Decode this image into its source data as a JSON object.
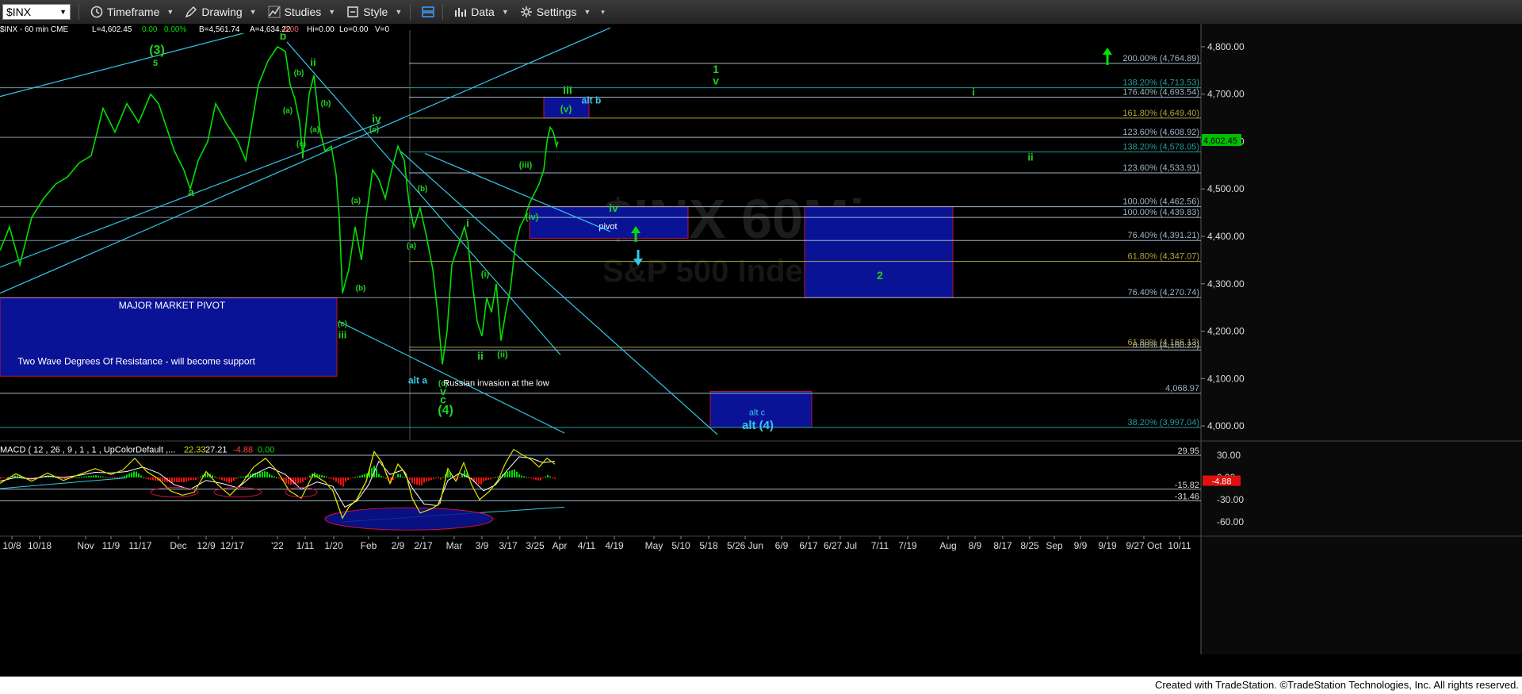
{
  "toolbar": {
    "symbol": "$INX",
    "items": [
      "Timeframe",
      "Drawing",
      "Studies",
      "Style",
      "Data",
      "Settings"
    ]
  },
  "colors": {
    "price": "#00e000",
    "cyan": "#33c8e8",
    "green_label": "#21d021",
    "pivot_fill": "#0a1396",
    "pivot_border": "#c0103a",
    "fib_line": "#9fb6c8",
    "fib_gold": "#8a8a20",
    "macd_line": "#e0e000",
    "macd_signal": "#ffffff",
    "hist_up": "#00e000",
    "hist_down": "#ff1010"
  },
  "chart_data": {
    "type": "line",
    "title": "$INX - 60 min CME",
    "header": {
      "symbol_label": "$INX - 60 min  CME",
      "last": "L=4,602.45",
      "change": "0.00",
      "pct": "0.00%",
      "bid": "B=4,561.74",
      "ask": "A=4,634.22",
      "hi_lo_change": "-0.00",
      "hi": "Hi=0.00",
      "lo": "Lo=0.00",
      "vol": "V=0"
    },
    "watermark": "$INX  60Min",
    "watermark2": "S&P 500 Index",
    "y_axis": {
      "ticks": [
        4000,
        4100,
        4200,
        4300,
        4400,
        4500,
        4600,
        4700,
        4800
      ],
      "tick_labels": [
        "4,000.00",
        "4,100.00",
        "4,200.00",
        "4,300.00",
        "4,400.00",
        "4,500.00",
        "4,600.00",
        "4,700.00",
        "4,800.00"
      ],
      "range": [
        3975,
        4835
      ],
      "last_price_label": "4,602.45"
    },
    "x_axis": {
      "tick_labels": [
        "10/8",
        "10/18",
        "Nov",
        "11/9",
        "11/17",
        "Dec",
        "12/9",
        "12/17",
        "'22",
        "1/11",
        "1/20",
        "Feb",
        "2/9",
        "2/17",
        "Mar",
        "3/9",
        "3/17",
        "3/25",
        "Apr",
        "4/11",
        "4/19",
        "May",
        "5/10",
        "5/18",
        "5/26 Jun",
        "6/9",
        "6/17",
        "6/27 Jul",
        "7/11",
        "7/19",
        "Aug",
        "8/9",
        "8/17",
        "8/25",
        "Sep",
        "9/9",
        "9/19",
        "9/27 Oct",
        "10/11"
      ]
    },
    "price_series": [
      [
        0,
        4370
      ],
      [
        12,
        4420
      ],
      [
        25,
        4340
      ],
      [
        40,
        4440
      ],
      [
        55,
        4480
      ],
      [
        70,
        4510
      ],
      [
        85,
        4525
      ],
      [
        100,
        4555
      ],
      [
        115,
        4570
      ],
      [
        130,
        4670
      ],
      [
        145,
        4620
      ],
      [
        160,
        4680
      ],
      [
        175,
        4640
      ],
      [
        190,
        4700
      ],
      [
        200,
        4680
      ],
      [
        208,
        4640
      ],
      [
        220,
        4580
      ],
      [
        232,
        4540
      ],
      [
        240,
        4500
      ],
      [
        250,
        4560
      ],
      [
        262,
        4600
      ],
      [
        272,
        4680
      ],
      [
        285,
        4640
      ],
      [
        300,
        4600
      ],
      [
        310,
        4560
      ],
      [
        318,
        4640
      ],
      [
        326,
        4720
      ],
      [
        338,
        4770
      ],
      [
        350,
        4800
      ],
      [
        360,
        4790
      ],
      [
        366,
        4720
      ],
      [
        372,
        4690
      ],
      [
        378,
        4640
      ],
      [
        382,
        4570
      ],
      [
        390,
        4700
      ],
      [
        396,
        4740
      ],
      [
        404,
        4620
      ],
      [
        410,
        4580
      ],
      [
        418,
        4590
      ],
      [
        424,
        4530
      ],
      [
        428,
        4440
      ],
      [
        432,
        4280
      ],
      [
        440,
        4330
      ],
      [
        448,
        4420
      ],
      [
        456,
        4350
      ],
      [
        462,
        4440
      ],
      [
        470,
        4540
      ],
      [
        478,
        4520
      ],
      [
        486,
        4480
      ],
      [
        494,
        4540
      ],
      [
        502,
        4590
      ],
      [
        510,
        4560
      ],
      [
        516,
        4470
      ],
      [
        522,
        4420
      ],
      [
        530,
        4460
      ],
      [
        538,
        4400
      ],
      [
        546,
        4330
      ],
      [
        552,
        4240
      ],
      [
        558,
        4130
      ],
      [
        564,
        4200
      ],
      [
        570,
        4340
      ],
      [
        578,
        4380
      ],
      [
        586,
        4420
      ],
      [
        590,
        4390
      ],
      [
        596,
        4300
      ],
      [
        602,
        4220
      ],
      [
        608,
        4190
      ],
      [
        614,
        4270
      ],
      [
        620,
        4240
      ],
      [
        626,
        4300
      ],
      [
        632,
        4180
      ],
      [
        638,
        4240
      ],
      [
        644,
        4290
      ],
      [
        650,
        4380
      ],
      [
        656,
        4420
      ],
      [
        662,
        4440
      ],
      [
        668,
        4470
      ],
      [
        674,
        4490
      ],
      [
        680,
        4510
      ],
      [
        686,
        4540
      ],
      [
        690,
        4600
      ],
      [
        694,
        4630
      ],
      [
        698,
        4620
      ],
      [
        702,
        4590
      ],
      [
        704,
        4600
      ]
    ],
    "fib_levels": [
      {
        "label": "200.00% (4,764.89)",
        "value": 4764.89,
        "color": "#9fb6c8"
      },
      {
        "label": "138.20% (4,713.53)",
        "value": 4713.53,
        "color": "#2a9a9a"
      },
      {
        "label": "176.40% (4,693.54)",
        "value": 4693.54,
        "color": "#9fb6c8"
      },
      {
        "label": "161.80% (4,649.40)",
        "value": 4649.4,
        "color": "#b0a040"
      },
      {
        "label": "123.60% (4,608.92)",
        "value": 4608.92,
        "color": "#9fb6c8"
      },
      {
        "label": "138.20% (4,578.05)",
        "value": 4578.05,
        "color": "#2a9a9a"
      },
      {
        "label": "123.60% (4,533.91)",
        "value": 4533.91,
        "color": "#9fb6c8"
      },
      {
        "label": "100.00% (4,462.56)",
        "value": 4462.56,
        "color": "#9fb6c8"
      },
      {
        "label": "100.00% (4,439.83)",
        "value": 4439.83,
        "color": "#9fb6c8"
      },
      {
        "label": "76.40% (4,391.21)",
        "value": 4391.21,
        "color": "#9fb6c8"
      },
      {
        "label": "61.80% (4,347.07)",
        "value": 4347.07,
        "color": "#b0a040"
      },
      {
        "label": "76.40% (4,270.74)",
        "value": 4270.74,
        "color": "#9fb6c8"
      },
      {
        "label": "61.80% (4,166.13)",
        "value": 4166.13,
        "color": "#b0a040"
      },
      {
        "label": "0.00% (4,160.23)",
        "value": 4160.23,
        "color": "#9fb6c8"
      },
      {
        "label": "4,068.97",
        "value": 4068.97,
        "color": "#9fb6c8"
      },
      {
        "label": "38.20% (3,997.04)",
        "value": 3997.04,
        "color": "#2a9a9a"
      }
    ],
    "boxes": [
      {
        "name": "major-market-pivot",
        "x0": 0,
        "x1": 425,
        "top": 4270,
        "bottom": 4105,
        "label": "MAJOR MARKET PIVOT",
        "label2": "Two Wave Degrees Of Resistance - will become support"
      },
      {
        "name": "pivot",
        "x0": 668,
        "x1": 868,
        "top": 4462.56,
        "bottom": 4396,
        "label": "pivot"
      },
      {
        "name": "wave-v-target",
        "x0": 686,
        "x1": 743,
        "top": 4693.54,
        "bottom": 4649.4,
        "label": "(v)"
      },
      {
        "name": "wave-2-target",
        "x0": 1015,
        "x1": 1202,
        "top": 4462.56,
        "bottom": 4270.74,
        "label": "2"
      },
      {
        "name": "alt-c-target",
        "x0": 896,
        "x1": 1024,
        "top": 4073,
        "bottom": 3997.04,
        "label": "alt c"
      }
    ],
    "wave_labels": [
      {
        "text": "b",
        "x": 357,
        "price": 4815,
        "color": "#21d021",
        "size": 14
      },
      {
        "text": "(3)",
        "x": 198,
        "price": 4785,
        "color": "#21d021",
        "size": 16
      },
      {
        "text": "5",
        "x": 196,
        "price": 4760,
        "color": "#21d021",
        "size": 11
      },
      {
        "text": "a",
        "x": 241,
        "price": 4485,
        "color": "#21d021",
        "size": 14
      },
      {
        "text": "ii",
        "x": 395,
        "price": 4760,
        "color": "#21d021",
        "size": 13
      },
      {
        "text": "(b)",
        "x": 377,
        "price": 4740,
        "color": "#21d021",
        "size": 10
      },
      {
        "text": "(b)",
        "x": 411,
        "price": 4675,
        "color": "#21d021",
        "size": 10
      },
      {
        "text": "(a)",
        "x": 363,
        "price": 4660,
        "color": "#21d021",
        "size": 10
      },
      {
        "text": "(a)",
        "x": 397,
        "price": 4620,
        "color": "#21d021",
        "size": 10
      },
      {
        "text": "(c)",
        "x": 380,
        "price": 4590,
        "color": "#21d021",
        "size": 10
      },
      {
        "text": "i",
        "x": 382,
        "price": 4565,
        "color": "#21d021",
        "size": 14
      },
      {
        "text": "iv",
        "x": 475,
        "price": 4640,
        "color": "#21d021",
        "size": 14
      },
      {
        "text": "(c)",
        "x": 472,
        "price": 4620,
        "color": "#21d021",
        "size": 10
      },
      {
        "text": "(a)",
        "x": 449,
        "price": 4470,
        "color": "#21d021",
        "size": 10
      },
      {
        "text": "(b)",
        "x": 533,
        "price": 4495,
        "color": "#21d021",
        "size": 10
      },
      {
        "text": "(a)",
        "x": 519,
        "price": 4375,
        "color": "#21d021",
        "size": 10
      },
      {
        "text": "(b)",
        "x": 455,
        "price": 4285,
        "color": "#21d021",
        "size": 10
      },
      {
        "text": "(c)",
        "x": 432,
        "price": 4210,
        "color": "#21d021",
        "size": 10
      },
      {
        "text": "iii",
        "x": 432,
        "price": 4185,
        "color": "#21d021",
        "size": 13
      },
      {
        "text": "i",
        "x": 590,
        "price": 4420,
        "color": "#21d021",
        "size": 14
      },
      {
        "text": "(i)",
        "x": 612,
        "price": 4315,
        "color": "#21d021",
        "size": 11
      },
      {
        "text": "ii",
        "x": 606,
        "price": 4140,
        "color": "#21d021",
        "size": 14
      },
      {
        "text": "(ii)",
        "x": 634,
        "price": 4145,
        "color": "#21d021",
        "size": 11
      },
      {
        "text": "(iii)",
        "x": 663,
        "price": 4545,
        "color": "#21d021",
        "size": 11
      },
      {
        "text": "(iv)",
        "x": 671,
        "price": 4435,
        "color": "#21d021",
        "size": 11
      },
      {
        "text": "iii",
        "x": 716,
        "price": 4700,
        "color": "#21d021",
        "size": 14
      },
      {
        "text": "(v)",
        "x": 714,
        "price": 4662,
        "color": "#21d021",
        "size": 12
      },
      {
        "text": "alt b",
        "x": 746,
        "price": 4680,
        "color": "#33c8e8",
        "size": 12
      },
      {
        "text": "iv",
        "x": 774,
        "price": 4452,
        "color": "#21d021",
        "size": 14
      },
      {
        "text": "1",
        "x": 903,
        "price": 4745,
        "color": "#21d021",
        "size": 14
      },
      {
        "text": "v",
        "x": 903,
        "price": 4720,
        "color": "#21d021",
        "size": 14
      },
      {
        "text": "i",
        "x": 1228,
        "price": 4697,
        "color": "#21d021",
        "size": 13
      },
      {
        "text": "ii",
        "x": 1300,
        "price": 4560,
        "color": "#21d021",
        "size": 13
      },
      {
        "text": "(c)",
        "x": 559,
        "price": 4085,
        "color": "#21d021",
        "size": 10
      },
      {
        "text": "v",
        "x": 559,
        "price": 4065,
        "color": "#21d021",
        "size": 14
      },
      {
        "text": "c",
        "x": 559,
        "price": 4048,
        "color": "#21d021",
        "size": 14
      },
      {
        "text": "(4)",
        "x": 562,
        "price": 4025,
        "color": "#21d021",
        "size": 16
      },
      {
        "text": "alt a",
        "x": 527,
        "price": 4090,
        "color": "#33c8e8",
        "size": 12
      },
      {
        "text": "alt (4)",
        "x": 956,
        "price": 3993,
        "color": "#33c8e8",
        "size": 15
      }
    ],
    "annotation": "Russian invasion at the low",
    "macd": {
      "label": "MACD ( 12 , 26 , 9 , 1 , 1 , UpColorDefault ,...",
      "values": [
        "22.33",
        "27.21",
        "-4.88",
        "0.00"
      ],
      "y_ticks": [
        30,
        0,
        -30,
        -60
      ],
      "y_tick_labels": [
        "30.00",
        "0.00",
        "-30.00",
        "-60.00"
      ],
      "range": [
        -75,
        45
      ],
      "levels": [
        {
          "label": "29.95",
          "value": 29.95
        },
        {
          "label": "-15.82",
          "value": -15.82
        },
        {
          "label": "-31.46",
          "value": -31.46
        }
      ],
      "last_label": "-4.88",
      "macd_line": [
        [
          0,
          -8
        ],
        [
          20,
          5
        ],
        [
          40,
          -5
        ],
        [
          60,
          6
        ],
        [
          80,
          -4
        ],
        [
          100,
          4
        ],
        [
          120,
          12
        ],
        [
          140,
          4
        ],
        [
          155,
          10
        ],
        [
          170,
          26
        ],
        [
          185,
          8
        ],
        [
          200,
          -2
        ],
        [
          215,
          -18
        ],
        [
          230,
          -24
        ],
        [
          245,
          -20
        ],
        [
          260,
          8
        ],
        [
          275,
          -10
        ],
        [
          290,
          -24
        ],
        [
          305,
          -8
        ],
        [
          320,
          14
        ],
        [
          335,
          26
        ],
        [
          350,
          8
        ],
        [
          365,
          -18
        ],
        [
          380,
          -28
        ],
        [
          395,
          4
        ],
        [
          410,
          -6
        ],
        [
          420,
          -18
        ],
        [
          432,
          -55
        ],
        [
          440,
          -40
        ],
        [
          450,
          -30
        ],
        [
          462,
          -5
        ],
        [
          472,
          35
        ],
        [
          482,
          20
        ],
        [
          492,
          -8
        ],
        [
          502,
          18
        ],
        [
          512,
          5
        ],
        [
          520,
          -28
        ],
        [
          530,
          -48
        ],
        [
          545,
          -42
        ],
        [
          555,
          -35
        ],
        [
          565,
          12
        ],
        [
          575,
          -5
        ],
        [
          585,
          20
        ],
        [
          595,
          -10
        ],
        [
          605,
          -30
        ],
        [
          618,
          -18
        ],
        [
          628,
          -4
        ],
        [
          638,
          20
        ],
        [
          648,
          38
        ],
        [
          660,
          30
        ],
        [
          670,
          24
        ],
        [
          680,
          14
        ],
        [
          690,
          26
        ],
        [
          700,
          18
        ]
      ],
      "signal_line": [
        [
          0,
          -5
        ],
        [
          20,
          0
        ],
        [
          40,
          -2
        ],
        [
          60,
          2
        ],
        [
          80,
          0
        ],
        [
          100,
          3
        ],
        [
          120,
          7
        ],
        [
          140,
          6
        ],
        [
          160,
          8
        ],
        [
          180,
          14
        ],
        [
          200,
          6
        ],
        [
          220,
          -10
        ],
        [
          240,
          -16
        ],
        [
          260,
          -4
        ],
        [
          280,
          -8
        ],
        [
          300,
          -14
        ],
        [
          320,
          4
        ],
        [
          340,
          14
        ],
        [
          360,
          4
        ],
        [
          380,
          -16
        ],
        [
          400,
          -6
        ],
        [
          420,
          -12
        ],
        [
          435,
          -40
        ],
        [
          450,
          -32
        ],
        [
          465,
          -10
        ],
        [
          478,
          22
        ],
        [
          492,
          4
        ],
        [
          508,
          10
        ],
        [
          520,
          -14
        ],
        [
          535,
          -36
        ],
        [
          552,
          -38
        ],
        [
          565,
          -4
        ],
        [
          580,
          6
        ],
        [
          595,
          -2
        ],
        [
          610,
          -18
        ],
        [
          625,
          -10
        ],
        [
          640,
          10
        ],
        [
          655,
          28
        ],
        [
          670,
          26
        ],
        [
          685,
          20
        ],
        [
          700,
          22
        ]
      ],
      "ellipses": [
        {
          "cx": 220,
          "cy": -20,
          "rx": 30,
          "ry": 6
        },
        {
          "cx": 300,
          "cy": -20,
          "rx": 30,
          "ry": 6
        },
        {
          "cx": 380,
          "cy": -20,
          "rx": 20,
          "ry": 6
        },
        {
          "cx": 516,
          "cy": -56,
          "rx": 106,
          "ry": 14
        }
      ]
    }
  },
  "footer": "Created with TradeStation. ©TradeStation Technologies, Inc. All rights reserved."
}
